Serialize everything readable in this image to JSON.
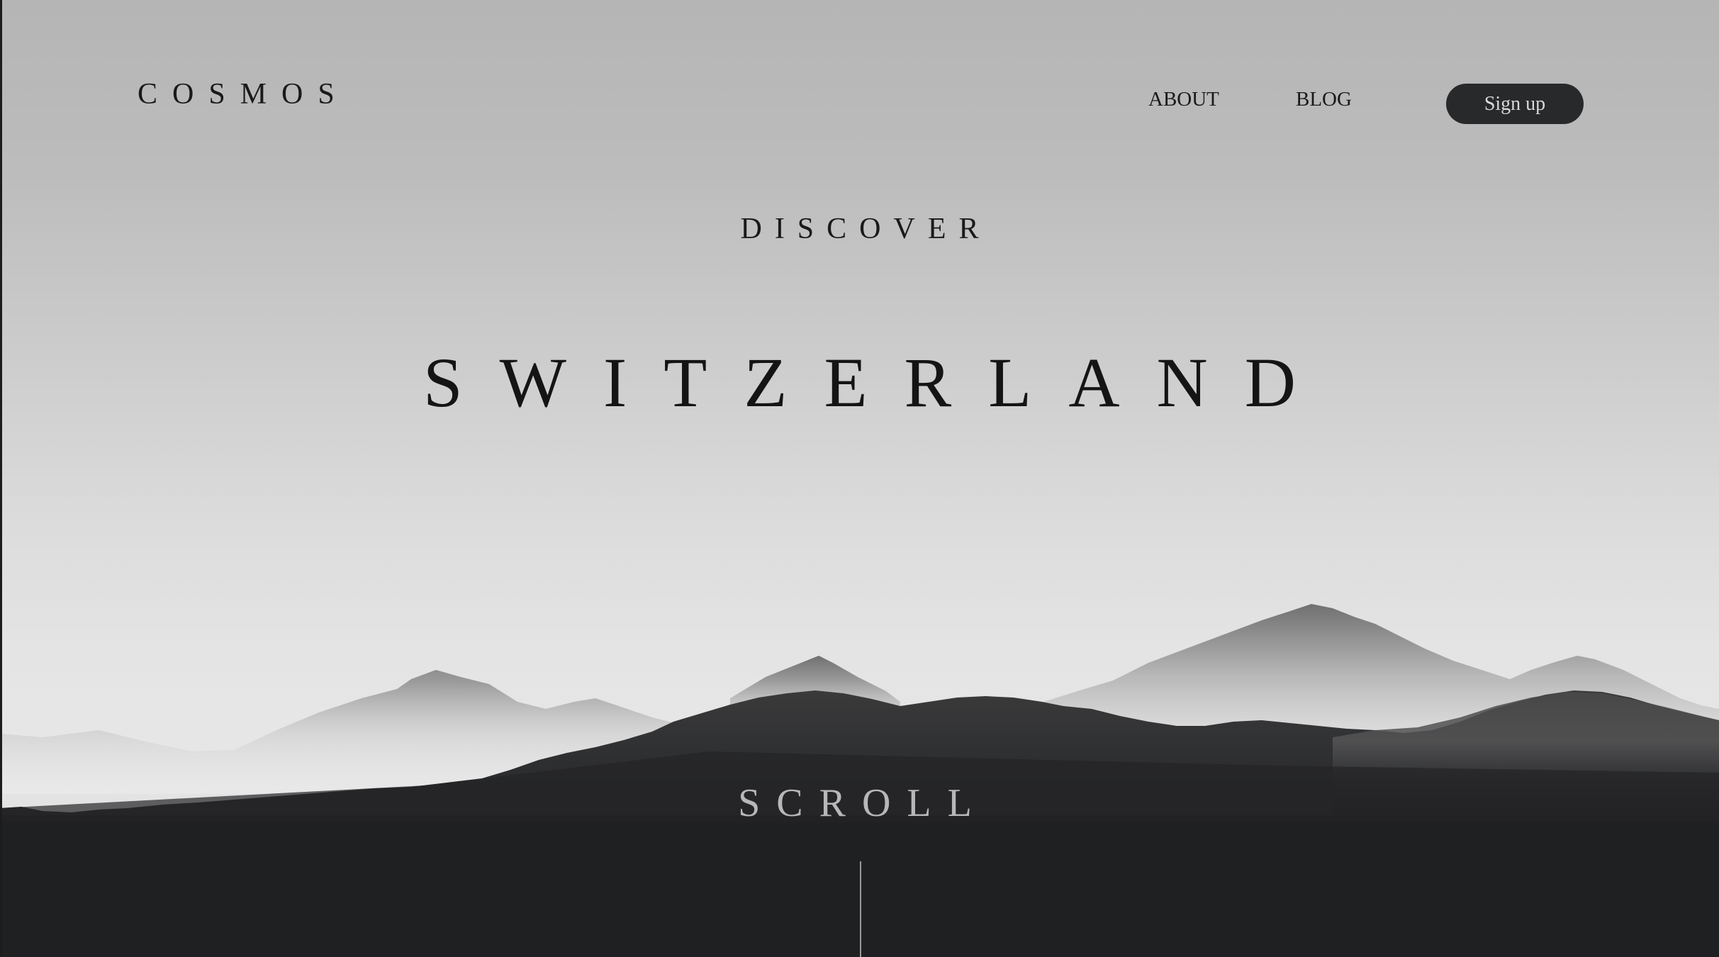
{
  "header": {
    "logo": "COSMOS",
    "nav": {
      "about": "ABOUT",
      "blog": "BLOG"
    },
    "signup_label": "Sign up"
  },
  "hero": {
    "eyebrow": "DISCOVER",
    "title": "SWITZERLAND",
    "scroll_label": "SCROLL"
  },
  "colors": {
    "sky_top": "#b5b5b5",
    "sky_bottom": "#e6e6e6",
    "forest": "#1f2022",
    "button_bg": "#28292b"
  }
}
